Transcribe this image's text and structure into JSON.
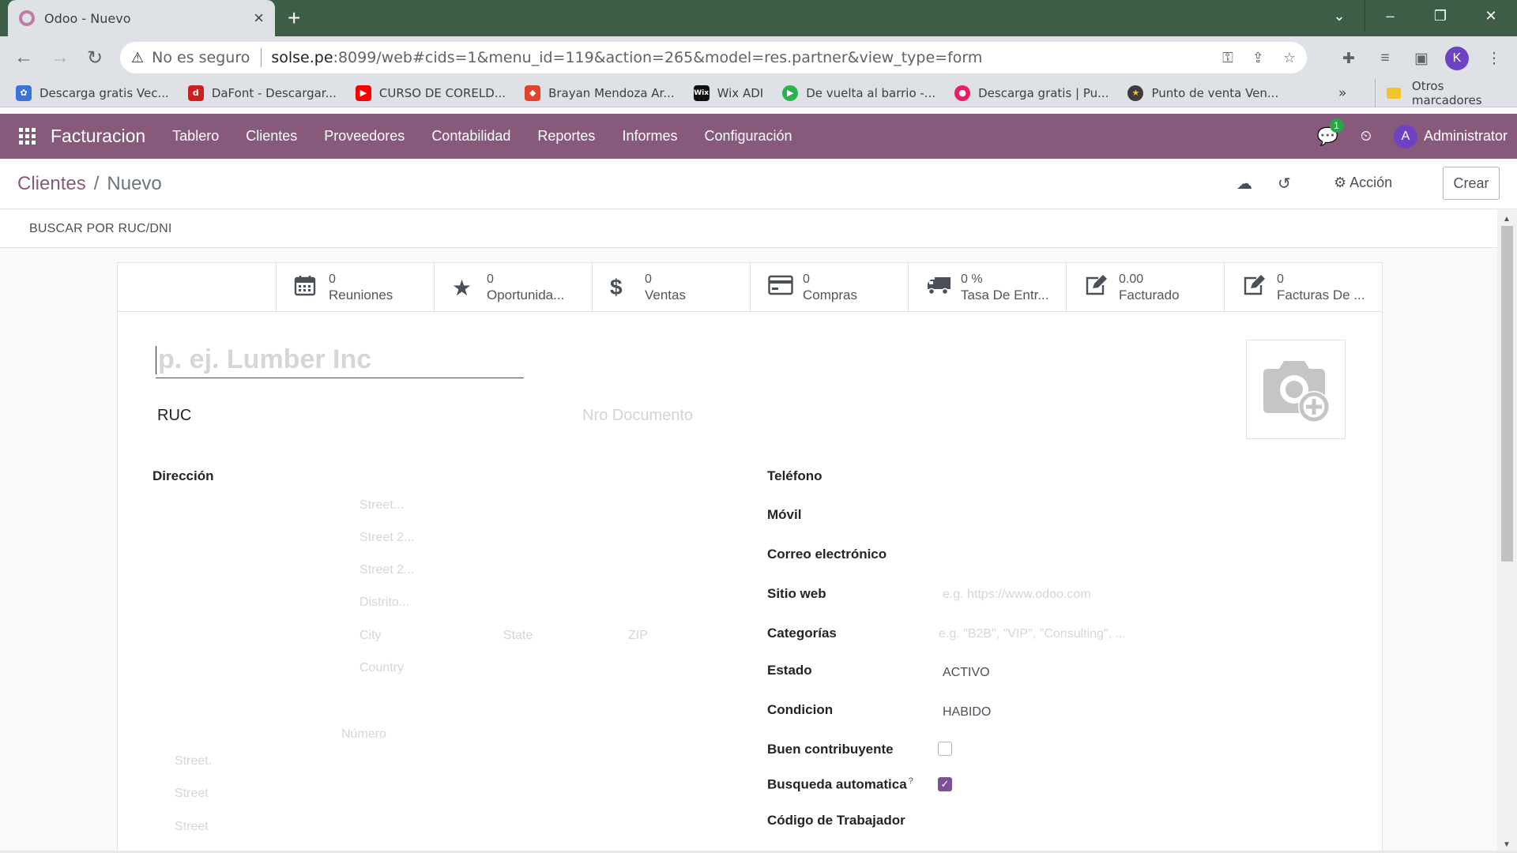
{
  "browser": {
    "tab_title": "Odoo - Nuevo",
    "new_tab": "+",
    "address": {
      "security_label": "No es seguro",
      "host": "solse.pe",
      "rest": ":8099/web#cids=1&menu_id=119&action=265&model=res.partner&view_type=form"
    },
    "profile_initial": "K",
    "bookmarks": [
      {
        "label": "Descarga gratis Vec...",
        "color": "#3b74d9",
        "icon": "freepik-icon"
      },
      {
        "label": "DaFont - Descargar...",
        "color": "#cc1f1f",
        "icon": "dafont-icon"
      },
      {
        "label": "CURSO DE CORELD...",
        "color": "#ff0000",
        "icon": "youtube-icon"
      },
      {
        "label": "Brayan Mendoza Ar...",
        "color": "#e24329",
        "icon": "gitlab-icon"
      },
      {
        "label": "Wix ADI",
        "color": "#111111",
        "icon": "wix-icon"
      },
      {
        "label": "De vuelta al barrio -...",
        "color": "#2bb24c",
        "icon": "play-icon"
      },
      {
        "label": "Descarga gratis | Pu...",
        "color": "#e91e63",
        "icon": "drop-icon"
      },
      {
        "label": "Punto de venta Ven...",
        "color": "#3c3c3c",
        "icon": "star-badge-icon"
      }
    ],
    "bookmarks_more": "»",
    "other_bookmarks": "Otros marcadores"
  },
  "odoo_nav": {
    "brand": "Facturacion",
    "menu": [
      "Tablero",
      "Clientes",
      "Proveedores",
      "Contabilidad",
      "Reportes",
      "Informes",
      "Configuración"
    ],
    "chat_count": "1",
    "user_initial": "A",
    "user_name": "Administrator"
  },
  "control_panel": {
    "breadcrumb_parent": "Clientes",
    "breadcrumb_sep": "/",
    "breadcrumb_current": "Nuevo",
    "action_label": "Acción",
    "create_label": "Crear"
  },
  "subbar": {
    "search_button": "BUSCAR POR RUC/DNI"
  },
  "smart_buttons": [
    {
      "icon": "calendar-icon",
      "value": "0",
      "label": "Reuniones"
    },
    {
      "icon": "star-icon",
      "value": "0",
      "label": "Oportunida..."
    },
    {
      "icon": "dollar-icon",
      "value": "0",
      "label": "Ventas"
    },
    {
      "icon": "credit-card-icon",
      "value": "0",
      "label": "Compras"
    },
    {
      "icon": "truck-icon",
      "value": "0 %",
      "label": "Tasa De Entr..."
    },
    {
      "icon": "edit-icon",
      "value": "0.00",
      "label": "Facturado"
    },
    {
      "icon": "edit-icon",
      "value": "0",
      "label": "Facturas De ..."
    }
  ],
  "form": {
    "name_placeholder": "p. ej. Lumber Inc",
    "doc_type": "RUC",
    "doc_number_placeholder": "Nro Documento",
    "address_label": "Dirección",
    "address": {
      "street": "Street...",
      "street2": "Street 2...",
      "street2b": "Street 2...",
      "district": "Distrito...",
      "city": "City",
      "state": "State",
      "zip": "ZIP",
      "country": "Country",
      "numero": "Número",
      "extra1": "Street.",
      "extra2": "Street",
      "extra3": "Street"
    },
    "right": {
      "telefono": "Teléfono",
      "movil": "Móvil",
      "correo": "Correo electrónico",
      "sitio_web": "Sitio web",
      "sitio_web_placeholder": "e.g. https://www.odoo.com",
      "categorias": "Categorías",
      "categorias_placeholder": "e.g. \"B2B\", \"VIP\", \"Consulting\", ...",
      "estado": "Estado",
      "estado_value": "ACTIVO",
      "condicion": "Condicion",
      "condicion_value": "HABIDO",
      "buen_contribuyente": "Buen contribuyente",
      "busqueda_automatica": "Busqueda automatica",
      "help_mark": "?",
      "codigo_trabajador": "Código de Trabajador"
    }
  },
  "colors": {
    "odoo_purple": "#875a7b",
    "checkbox_checked": "#7c5295",
    "tabstrip": "#3d5d47"
  }
}
